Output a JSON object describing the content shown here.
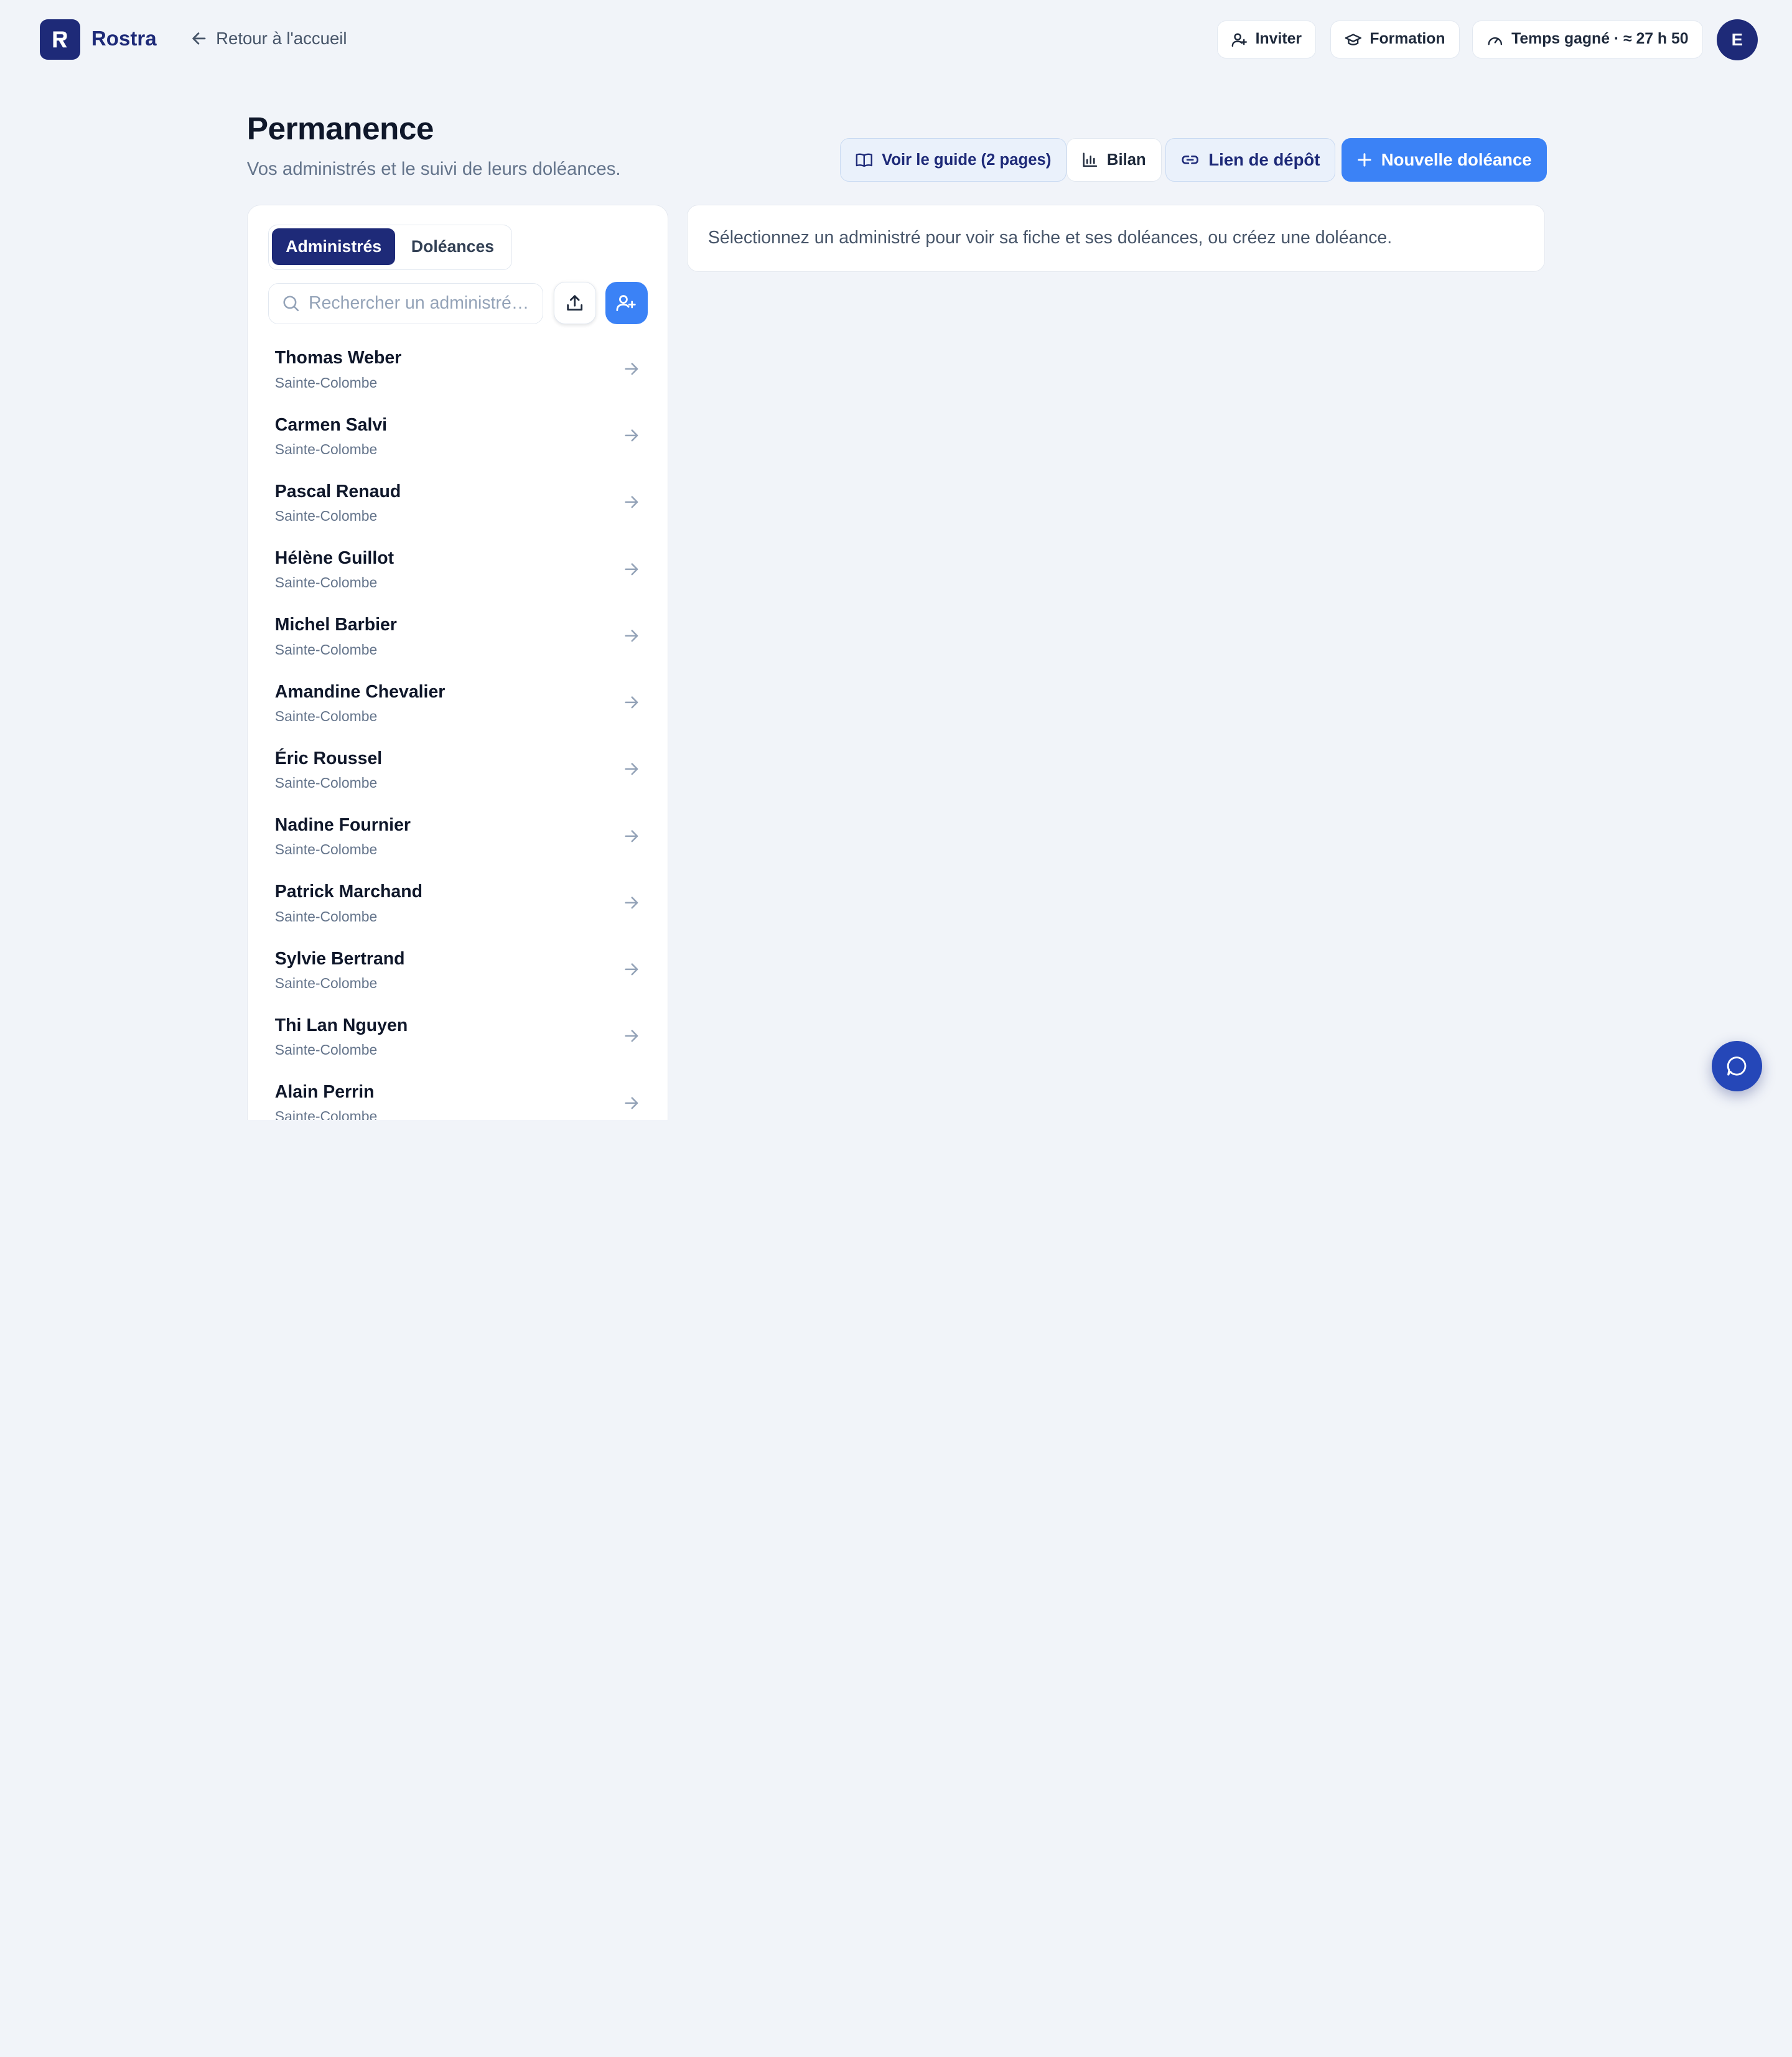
{
  "app": {
    "brand": "Rostra",
    "back_link": "Retour à l'accueil",
    "logo_letter": "R"
  },
  "topbar": {
    "invite_label": "Inviter",
    "formation_label": "Formation",
    "time_saved_label": "Temps gagné · ≈ 27 h 50",
    "avatar_initial": "E"
  },
  "header": {
    "title": "Permanence",
    "subtitle": "Vos administrés et le suivi de leurs doléances."
  },
  "actions": {
    "guide_label": "Voir le guide (2 pages)",
    "bilan_label": "Bilan",
    "lien_label": "Lien de dépôt",
    "new_label": "Nouvelle doléance"
  },
  "tabs": [
    {
      "label": "Administrés",
      "active": true
    },
    {
      "label": "Doléances",
      "active": false
    }
  ],
  "search": {
    "placeholder": "Rechercher un administré…",
    "value": ""
  },
  "administres": [
    {
      "name": "Thomas Weber",
      "city": "Sainte-Colombe"
    },
    {
      "name": "Carmen Salvi",
      "city": "Sainte-Colombe"
    },
    {
      "name": "Pascal Renaud",
      "city": "Sainte-Colombe"
    },
    {
      "name": "Hélène Guillot",
      "city": "Sainte-Colombe"
    },
    {
      "name": "Michel Barbier",
      "city": "Sainte-Colombe"
    },
    {
      "name": "Amandine Chevalier",
      "city": "Sainte-Colombe"
    },
    {
      "name": "Éric Roussel",
      "city": "Sainte-Colombe"
    },
    {
      "name": "Nadine Fournier",
      "city": "Sainte-Colombe"
    },
    {
      "name": "Patrick Marchand",
      "city": "Sainte-Colombe"
    },
    {
      "name": "Sylvie Bertrand",
      "city": "Sainte-Colombe"
    },
    {
      "name": "Thi Lan Nguyen",
      "city": "Sainte-Colombe"
    },
    {
      "name": "Alain Perrin",
      "city": "Sainte-Colombe"
    }
  ],
  "detail": {
    "empty_message": "Sélectionnez un administré pour voir sa fiche et ses doléances, ou créez une doléance."
  },
  "colors": {
    "brand": "#1e2a78",
    "accent": "#3b82f6",
    "background": "#f1f4f9"
  },
  "icons": {
    "back": "arrow-left-icon",
    "invite": "user-plus-icon",
    "formation": "graduation-cap-icon",
    "time_saved": "gauge-icon",
    "guide": "book-open-icon",
    "bilan": "bar-chart-icon",
    "lien": "link-icon",
    "new": "plus-icon",
    "search": "search-icon",
    "export": "upload-icon",
    "add_user": "user-plus-icon",
    "row": "arrow-right-icon",
    "chat": "chat-bubble-icon"
  }
}
